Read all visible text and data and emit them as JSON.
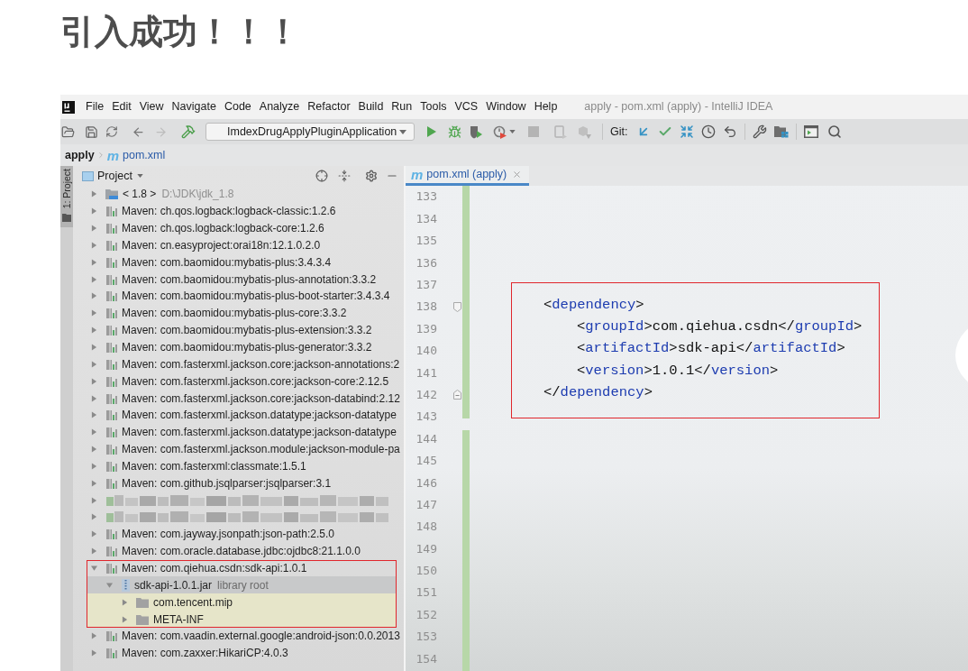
{
  "heading": "引入成功！！！",
  "menu_bar": {
    "items": [
      "File",
      "Edit",
      "View",
      "Navigate",
      "Code",
      "Analyze",
      "Refactor",
      "Build",
      "Run",
      "Tools",
      "VCS",
      "Window",
      "Help"
    ],
    "title": "apply - pom.xml (apply) - IntelliJ IDEA"
  },
  "toolbar": {
    "run_configuration": "ImdexDrugApplyPluginApplication",
    "git_label": "Git:"
  },
  "breadcrumb": [
    {
      "kind": "project",
      "label": "apply"
    },
    {
      "kind": "maven_file",
      "icon_text": "m",
      "label": "pom.xml"
    }
  ],
  "side_tab": {
    "label": "1: Project",
    "selected": true
  },
  "project_panel": {
    "title": "Project",
    "tree": [
      {
        "kind": "sdk",
        "label": "< 1.8 >",
        "hint": "D:\\JDK\\jdk_1.8",
        "expanded": false,
        "selected": false,
        "outlined": false
      },
      {
        "kind": "library",
        "label": "Maven: ch.qos.logback:logback-classic:1.2.6",
        "expanded": false,
        "selected": false,
        "outlined": false
      },
      {
        "kind": "library",
        "label": "Maven: ch.qos.logback:logback-core:1.2.6",
        "expanded": false,
        "selected": false,
        "outlined": false
      },
      {
        "kind": "library",
        "label": "Maven: cn.easyproject:orai18n:12.1.0.2.0",
        "expanded": false,
        "selected": false,
        "outlined": false
      },
      {
        "kind": "library",
        "label": "Maven: com.baomidou:mybatis-plus:3.4.3.4",
        "expanded": false,
        "selected": false,
        "outlined": false
      },
      {
        "kind": "library",
        "label": "Maven: com.baomidou:mybatis-plus-annotation:3.3.2",
        "expanded": false,
        "selected": false,
        "outlined": false
      },
      {
        "kind": "library",
        "label": "Maven: com.baomidou:mybatis-plus-boot-starter:3.4.3.4",
        "expanded": false,
        "selected": false,
        "outlined": false
      },
      {
        "kind": "library",
        "label": "Maven: com.baomidou:mybatis-plus-core:3.3.2",
        "expanded": false,
        "selected": false,
        "outlined": false
      },
      {
        "kind": "library",
        "label": "Maven: com.baomidou:mybatis-plus-extension:3.3.2",
        "expanded": false,
        "selected": false,
        "outlined": false
      },
      {
        "kind": "library",
        "label": "Maven: com.baomidou:mybatis-plus-generator:3.3.2",
        "expanded": false,
        "selected": false,
        "outlined": false
      },
      {
        "kind": "library",
        "label": "Maven: com.fasterxml.jackson.core:jackson-annotations:2",
        "expanded": false,
        "selected": false,
        "outlined": false
      },
      {
        "kind": "library",
        "label": "Maven: com.fasterxml.jackson.core:jackson-core:2.12.5",
        "expanded": false,
        "selected": false,
        "outlined": false
      },
      {
        "kind": "library",
        "label": "Maven: com.fasterxml.jackson.core:jackson-databind:2.12",
        "expanded": false,
        "selected": false,
        "outlined": false
      },
      {
        "kind": "library",
        "label": "Maven: com.fasterxml.jackson.datatype:jackson-datatype",
        "expanded": false,
        "selected": false,
        "outlined": false
      },
      {
        "kind": "library",
        "label": "Maven: com.fasterxml.jackson.datatype:jackson-datatype",
        "expanded": false,
        "selected": false,
        "outlined": false
      },
      {
        "kind": "library",
        "label": "Maven: com.fasterxml.jackson.module:jackson-module-pa",
        "expanded": false,
        "selected": false,
        "outlined": false
      },
      {
        "kind": "library",
        "label": "Maven: com.fasterxml:classmate:1.5.1",
        "expanded": false,
        "selected": false,
        "outlined": false
      },
      {
        "kind": "library",
        "label": "Maven: com.github.jsqlparser:jsqlparser:3.1",
        "expanded": false,
        "selected": false,
        "outlined": false
      },
      {
        "kind": "redacted",
        "expanded": false,
        "selected": false,
        "outlined": false
      },
      {
        "kind": "redacted",
        "expanded": false,
        "selected": false,
        "outlined": false
      },
      {
        "kind": "library",
        "label": "Maven: com.jayway.jsonpath:json-path:2.5.0",
        "expanded": false,
        "selected": false,
        "outlined": false
      },
      {
        "kind": "library",
        "label": "Maven: com.oracle.database.jdbc:ojdbc8:21.1.0.0",
        "expanded": false,
        "selected": false,
        "outlined": false
      },
      {
        "kind": "library",
        "label": "Maven: com.qiehua.csdn:sdk-api:1.0.1",
        "expanded": true,
        "selected": false,
        "outlined": true,
        "children": [
          {
            "kind": "jar",
            "label": "sdk-api-1.0.1.jar",
            "hint": "library root",
            "expanded": true,
            "selected": true,
            "children": [
              {
                "kind": "package",
                "label": "com.tencent.mip",
                "expanded": false,
                "selected": false,
                "tinted": true
              },
              {
                "kind": "package",
                "label": "META-INF",
                "expanded": false,
                "selected": false,
                "tinted": true
              }
            ]
          }
        ]
      },
      {
        "kind": "library",
        "label": "Maven: com.vaadin.external.google:android-json:0.0.2013",
        "expanded": false,
        "selected": false,
        "outlined": false
      },
      {
        "kind": "library",
        "label": "Maven: com.zaxxer:HikariCP:4.0.3",
        "expanded": false,
        "selected": false,
        "outlined": false
      }
    ]
  },
  "editor": {
    "tabs": [
      {
        "icon_text": "m",
        "label": "pom.xml (apply)",
        "selected": true
      }
    ],
    "line_numbers": [
      {
        "number": "133",
        "kind": "plain"
      },
      {
        "number": "134",
        "kind": "plain"
      },
      {
        "number": "135",
        "kind": "plain"
      },
      {
        "number": "136",
        "kind": "plain"
      },
      {
        "number": "137",
        "kind": "plain"
      },
      {
        "number": "138",
        "kind": "fold_start"
      },
      {
        "number": "139",
        "kind": "plain"
      },
      {
        "number": "140",
        "kind": "plain"
      },
      {
        "number": "141",
        "kind": "plain"
      },
      {
        "number": "142",
        "kind": "fold_end"
      },
      {
        "number": "143",
        "kind": "plain"
      },
      {
        "number": "144",
        "kind": "plain"
      },
      {
        "number": "145",
        "kind": "plain"
      },
      {
        "number": "146",
        "kind": "plain"
      },
      {
        "number": "147",
        "kind": "plain"
      },
      {
        "number": "148",
        "kind": "plain"
      },
      {
        "number": "149",
        "kind": "plain"
      },
      {
        "number": "150",
        "kind": "plain"
      },
      {
        "number": "151",
        "kind": "plain"
      },
      {
        "number": "152",
        "kind": "plain"
      },
      {
        "number": "153",
        "kind": "plain"
      },
      {
        "number": "154",
        "kind": "plain"
      }
    ],
    "code_block": {
      "outlined": true,
      "lines": [
        {
          "code": "<dependency>",
          "children": [
            {
              "code": "<groupId>com.qiehua.csdn</groupId>"
            },
            {
              "code": "<artifactId>sdk-api</artifactId>"
            },
            {
              "code": "<version>1.0.1</version>"
            }
          ]
        },
        {
          "code": "</dependency>"
        }
      ]
    }
  }
}
